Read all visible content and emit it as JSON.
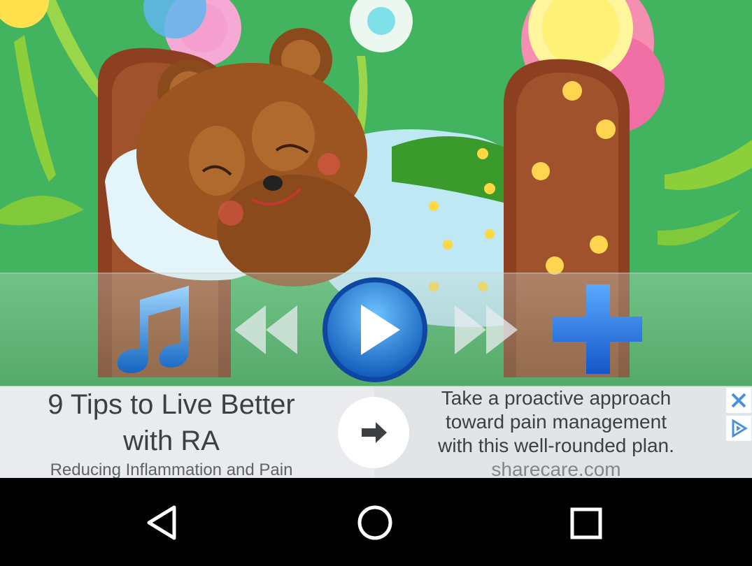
{
  "player": {
    "controls": [
      {
        "name": "playlist",
        "icon": "music-note-icon"
      },
      {
        "name": "rewind",
        "icon": "rewind-icon"
      },
      {
        "name": "play",
        "icon": "play-icon"
      },
      {
        "name": "fast-forward",
        "icon": "fast-forward-icon"
      },
      {
        "name": "add",
        "icon": "plus-icon"
      }
    ]
  },
  "ad": {
    "headline_line1": "9 Tips to Live Better",
    "headline_line2": "with RA",
    "headline_sub": "Reducing Inflammation and Pain",
    "body_line1": "Take a proactive approach",
    "body_line2": "toward pain management",
    "body_line3": "with this well-rounded plan.",
    "domain": "sharecare.com",
    "arrow_icon": "arrow-right-icon",
    "close_icon": "close-icon",
    "adchoices_icon": "adchoices-icon"
  },
  "navbar": {
    "back_icon": "back-triangle-icon",
    "home_icon": "home-circle-icon",
    "recents_icon": "recents-square-icon"
  },
  "colors": {
    "background_green": "#3fae5a",
    "accent_blue": "#1a6fd6",
    "ad_text": "#3c4043",
    "ad_domain": "#80868b",
    "navbar": "#000000"
  }
}
